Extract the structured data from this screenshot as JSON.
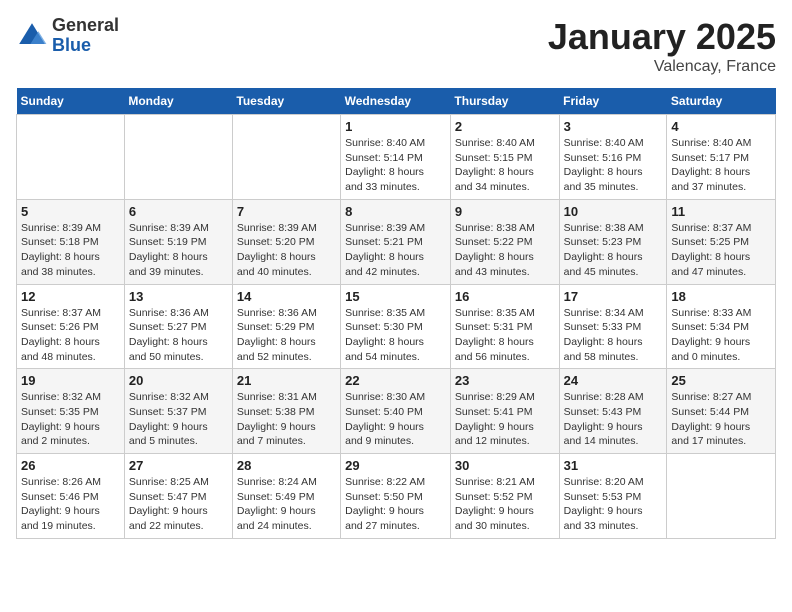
{
  "logo": {
    "general": "General",
    "blue": "Blue"
  },
  "title": "January 2025",
  "subtitle": "Valencay, France",
  "days_of_week": [
    "Sunday",
    "Monday",
    "Tuesday",
    "Wednesday",
    "Thursday",
    "Friday",
    "Saturday"
  ],
  "weeks": [
    [
      {
        "day": "",
        "info": ""
      },
      {
        "day": "",
        "info": ""
      },
      {
        "day": "",
        "info": ""
      },
      {
        "day": "1",
        "info": "Sunrise: 8:40 AM\nSunset: 5:14 PM\nDaylight: 8 hours\nand 33 minutes."
      },
      {
        "day": "2",
        "info": "Sunrise: 8:40 AM\nSunset: 5:15 PM\nDaylight: 8 hours\nand 34 minutes."
      },
      {
        "day": "3",
        "info": "Sunrise: 8:40 AM\nSunset: 5:16 PM\nDaylight: 8 hours\nand 35 minutes."
      },
      {
        "day": "4",
        "info": "Sunrise: 8:40 AM\nSunset: 5:17 PM\nDaylight: 8 hours\nand 37 minutes."
      }
    ],
    [
      {
        "day": "5",
        "info": "Sunrise: 8:39 AM\nSunset: 5:18 PM\nDaylight: 8 hours\nand 38 minutes."
      },
      {
        "day": "6",
        "info": "Sunrise: 8:39 AM\nSunset: 5:19 PM\nDaylight: 8 hours\nand 39 minutes."
      },
      {
        "day": "7",
        "info": "Sunrise: 8:39 AM\nSunset: 5:20 PM\nDaylight: 8 hours\nand 40 minutes."
      },
      {
        "day": "8",
        "info": "Sunrise: 8:39 AM\nSunset: 5:21 PM\nDaylight: 8 hours\nand 42 minutes."
      },
      {
        "day": "9",
        "info": "Sunrise: 8:38 AM\nSunset: 5:22 PM\nDaylight: 8 hours\nand 43 minutes."
      },
      {
        "day": "10",
        "info": "Sunrise: 8:38 AM\nSunset: 5:23 PM\nDaylight: 8 hours\nand 45 minutes."
      },
      {
        "day": "11",
        "info": "Sunrise: 8:37 AM\nSunset: 5:25 PM\nDaylight: 8 hours\nand 47 minutes."
      }
    ],
    [
      {
        "day": "12",
        "info": "Sunrise: 8:37 AM\nSunset: 5:26 PM\nDaylight: 8 hours\nand 48 minutes."
      },
      {
        "day": "13",
        "info": "Sunrise: 8:36 AM\nSunset: 5:27 PM\nDaylight: 8 hours\nand 50 minutes."
      },
      {
        "day": "14",
        "info": "Sunrise: 8:36 AM\nSunset: 5:29 PM\nDaylight: 8 hours\nand 52 minutes."
      },
      {
        "day": "15",
        "info": "Sunrise: 8:35 AM\nSunset: 5:30 PM\nDaylight: 8 hours\nand 54 minutes."
      },
      {
        "day": "16",
        "info": "Sunrise: 8:35 AM\nSunset: 5:31 PM\nDaylight: 8 hours\nand 56 minutes."
      },
      {
        "day": "17",
        "info": "Sunrise: 8:34 AM\nSunset: 5:33 PM\nDaylight: 8 hours\nand 58 minutes."
      },
      {
        "day": "18",
        "info": "Sunrise: 8:33 AM\nSunset: 5:34 PM\nDaylight: 9 hours\nand 0 minutes."
      }
    ],
    [
      {
        "day": "19",
        "info": "Sunrise: 8:32 AM\nSunset: 5:35 PM\nDaylight: 9 hours\nand 2 minutes."
      },
      {
        "day": "20",
        "info": "Sunrise: 8:32 AM\nSunset: 5:37 PM\nDaylight: 9 hours\nand 5 minutes."
      },
      {
        "day": "21",
        "info": "Sunrise: 8:31 AM\nSunset: 5:38 PM\nDaylight: 9 hours\nand 7 minutes."
      },
      {
        "day": "22",
        "info": "Sunrise: 8:30 AM\nSunset: 5:40 PM\nDaylight: 9 hours\nand 9 minutes."
      },
      {
        "day": "23",
        "info": "Sunrise: 8:29 AM\nSunset: 5:41 PM\nDaylight: 9 hours\nand 12 minutes."
      },
      {
        "day": "24",
        "info": "Sunrise: 8:28 AM\nSunset: 5:43 PM\nDaylight: 9 hours\nand 14 minutes."
      },
      {
        "day": "25",
        "info": "Sunrise: 8:27 AM\nSunset: 5:44 PM\nDaylight: 9 hours\nand 17 minutes."
      }
    ],
    [
      {
        "day": "26",
        "info": "Sunrise: 8:26 AM\nSunset: 5:46 PM\nDaylight: 9 hours\nand 19 minutes."
      },
      {
        "day": "27",
        "info": "Sunrise: 8:25 AM\nSunset: 5:47 PM\nDaylight: 9 hours\nand 22 minutes."
      },
      {
        "day": "28",
        "info": "Sunrise: 8:24 AM\nSunset: 5:49 PM\nDaylight: 9 hours\nand 24 minutes."
      },
      {
        "day": "29",
        "info": "Sunrise: 8:22 AM\nSunset: 5:50 PM\nDaylight: 9 hours\nand 27 minutes."
      },
      {
        "day": "30",
        "info": "Sunrise: 8:21 AM\nSunset: 5:52 PM\nDaylight: 9 hours\nand 30 minutes."
      },
      {
        "day": "31",
        "info": "Sunrise: 8:20 AM\nSunset: 5:53 PM\nDaylight: 9 hours\nand 33 minutes."
      },
      {
        "day": "",
        "info": ""
      }
    ]
  ]
}
